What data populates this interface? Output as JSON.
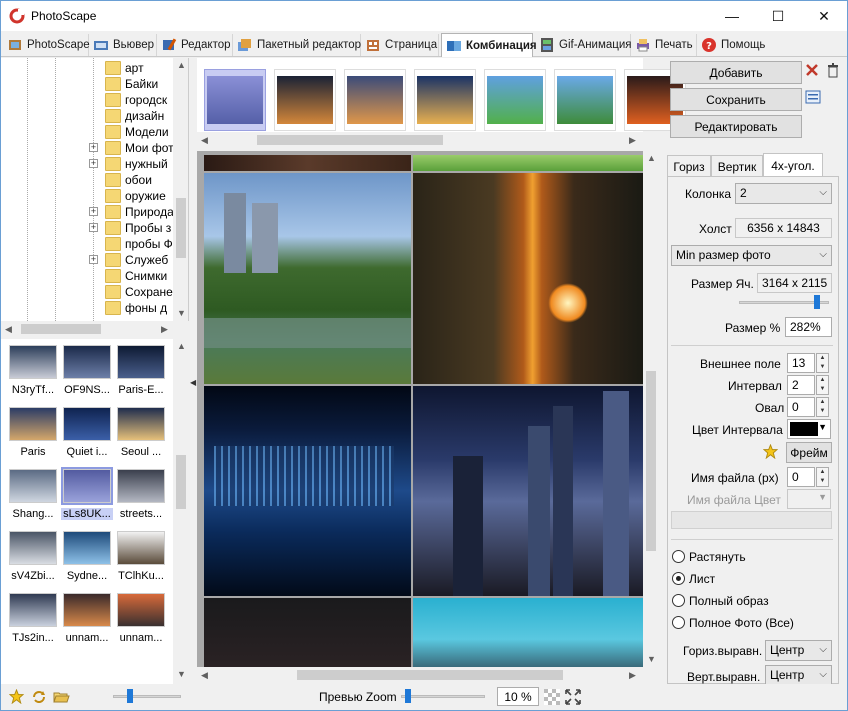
{
  "window": {
    "title": "PhotoScape",
    "minimize_glyph": "—",
    "maximize_glyph": "☐",
    "close_glyph": "✕"
  },
  "tabs": [
    {
      "label": "PhotoScape",
      "icon": "photoscape-icon",
      "color": "#c0392b"
    },
    {
      "label": "Вьювер",
      "icon": "viewer-icon",
      "color": "#3a6fb0"
    },
    {
      "label": "Редактор",
      "icon": "editor-icon",
      "color": "#d35400"
    },
    {
      "label": "Пакетный редактор",
      "icon": "batch-editor-icon",
      "color": "#d35400"
    },
    {
      "label": "Страница",
      "icon": "page-icon",
      "color": "#e67e22"
    },
    {
      "label": "Комбинация",
      "icon": "combine-icon",
      "color": "#2e86c1",
      "active": true
    },
    {
      "label": "Gif-Анимация",
      "icon": "gif-animation-icon",
      "color": "#27ae60"
    },
    {
      "label": "Печать",
      "icon": "print-icon",
      "color": "#8e44ad"
    },
    {
      "label": "Помощь",
      "icon": "help-icon",
      "color": "#e74c3c"
    }
  ],
  "tree": {
    "items": [
      {
        "label": "арт",
        "expand": false
      },
      {
        "label": "Байки",
        "expand": false
      },
      {
        "label": "городск",
        "expand": false
      },
      {
        "label": "дизайн",
        "expand": false
      },
      {
        "label": "Модели",
        "expand": false
      },
      {
        "label": "Мои фот",
        "expand": true
      },
      {
        "label": "нужный",
        "expand": true
      },
      {
        "label": "обои",
        "expand": false
      },
      {
        "label": "оружие",
        "expand": false
      },
      {
        "label": "Природа",
        "expand": true
      },
      {
        "label": "Пробы з",
        "expand": true
      },
      {
        "label": "пробы Ф",
        "expand": false
      },
      {
        "label": "Служеб",
        "expand": true
      },
      {
        "label": "Снимки",
        "expand": false
      },
      {
        "label": "Сохране",
        "expand": false
      },
      {
        "label": "фоны д",
        "expand": false
      }
    ]
  },
  "files": [
    {
      "name": "N3ryTf...",
      "c1": "#2c3e5a",
      "c2": "#c8cbd6"
    },
    {
      "name": "OF9NS...",
      "c1": "#1b2a4a",
      "c2": "#6d7fa8"
    },
    {
      "name": "Paris-E...",
      "c1": "#0e1a33",
      "c2": "#4a5f8c"
    },
    {
      "name": "Paris",
      "c1": "#2b3c66",
      "c2": "#d4a76a"
    },
    {
      "name": "Quiet i...",
      "c1": "#0f2350",
      "c2": "#3b5fa8"
    },
    {
      "name": "Seoul ...",
      "c1": "#1f2d4d",
      "c2": "#e6c07a"
    },
    {
      "name": "Shang...",
      "c1": "#5b6b84",
      "c2": "#cfd6e0"
    },
    {
      "name": "sLs8UK...",
      "c1": "#535ba0",
      "c2": "#9aa2db",
      "selected": true
    },
    {
      "name": "streets...",
      "c1": "#3a3f4d",
      "c2": "#b3b7c2"
    },
    {
      "name": "sV4Zbi...",
      "c1": "#4a5566",
      "c2": "#d9dde3"
    },
    {
      "name": "Sydne...",
      "c1": "#1e4a7a",
      "c2": "#8ec1e8"
    },
    {
      "name": "TClhKu...",
      "c1": "#f2f2f2",
      "c2": "#5a4b3a"
    },
    {
      "name": "TJs2in...",
      "c1": "#2f3a52",
      "c2": "#c9d0dd"
    },
    {
      "name": "unnam...",
      "c1": "#3a2a2a",
      "c2": "#d88a4a"
    },
    {
      "name": "unnam...",
      "c1": "#d86a3a",
      "c2": "#3a3030"
    }
  ],
  "strip": [
    {
      "c1": "#8a90d6",
      "c2": "#5560a8",
      "selected": true
    },
    {
      "c1": "#1a2235",
      "c2": "#d4873a"
    },
    {
      "c1": "#3b4b7a",
      "c2": "#e0974a"
    },
    {
      "c1": "#1a3366",
      "c2": "#e8b050"
    },
    {
      "c1": "#5fa0e0",
      "c2": "#52b04a"
    },
    {
      "c1": "#6aa9e8",
      "c2": "#3e8c3a"
    },
    {
      "c1": "#2a1a1a",
      "c2": "#e06020"
    }
  ],
  "right": {
    "add_label": "Добавить",
    "save_label": "Сохранить",
    "edit_label": "Редактировать",
    "tabs": [
      "Гориз",
      "Вертик",
      "4х-угол."
    ],
    "column_label": "Колонка",
    "column_value": "2",
    "canvas_label": "Холст",
    "canvas_value": "6356 x 14843",
    "size_mode_value": "Min размер фото",
    "cell_size_label": "Размер Яч.",
    "cell_size_value": "3164 x 2115",
    "size_pct_label": "Размер %",
    "size_pct_value": "282%",
    "outer_label": "Внешнее поле",
    "outer_value": "13",
    "interval_label": "Интервал",
    "interval_value": "2",
    "oval_label": "Овал",
    "oval_value": "0",
    "interval_color_label": "Цвет Интервала",
    "interval_color": "#000000",
    "frame_label": "Фрейм",
    "filename_label": "Имя файла (px)",
    "filename_value": "0",
    "filename_color_label": "Имя файла Цвет",
    "radio_stretch": "Растянуть",
    "radio_sheet": "Лист",
    "radio_full": "Полный образ",
    "radio_full_photo": "Полное Фото (Все)",
    "halign_label": "Гориз.выравн.",
    "halign_value": "Центр",
    "valign_label": "Верт.выравн.",
    "valign_value": "Центр"
  },
  "bottom": {
    "preview_zoom_label": "Превью Zoom",
    "zoom_value": "10 %"
  }
}
